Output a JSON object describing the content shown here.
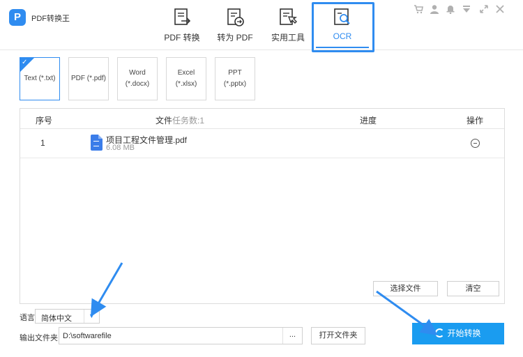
{
  "app": {
    "logo_letter": "P",
    "name": "PDF转换王"
  },
  "tabs": [
    {
      "label": "PDF 转换",
      "icon": "pdf-convert-icon"
    },
    {
      "label": "转为 PDF",
      "icon": "to-pdf-icon"
    },
    {
      "label": "实用工具",
      "icon": "tools-icon"
    },
    {
      "label": "OCR",
      "icon": "ocr-scan-icon",
      "active": true
    }
  ],
  "window_controls": [
    "cart-icon",
    "user-icon",
    "bell-icon",
    "dropdown-icon",
    "restore-icon",
    "close-icon"
  ],
  "formats": [
    {
      "label": "Text (*.txt)",
      "selected": true
    },
    {
      "label": "PDF (*.pdf)",
      "selected": false
    },
    {
      "label": "Word\n(*.docx)",
      "selected": false
    },
    {
      "label": "Excel (*.xlsx)",
      "selected": false
    },
    {
      "label": "PPT (*.pptx)",
      "selected": false
    }
  ],
  "file_table": {
    "headers": {
      "index": "序号",
      "file": "文件",
      "task_count": "任务数:1",
      "progress": "进度",
      "action": "操作"
    },
    "rows": [
      {
        "index": "1",
        "name": "项目工程文件管理.pdf",
        "size": "6.08 MB"
      }
    ]
  },
  "buttons": {
    "select_file": "选择文件",
    "clear": "清空",
    "open_folder": "打开文件夹",
    "start": "开始转换",
    "browse": "..."
  },
  "language": {
    "label": "语言:",
    "value": "简体中文"
  },
  "output": {
    "label": "输出文件夹:",
    "path": "D:\\softwarefile"
  },
  "colors": {
    "accent": "#2f8cf0",
    "primary_button": "#1a9cf0"
  }
}
